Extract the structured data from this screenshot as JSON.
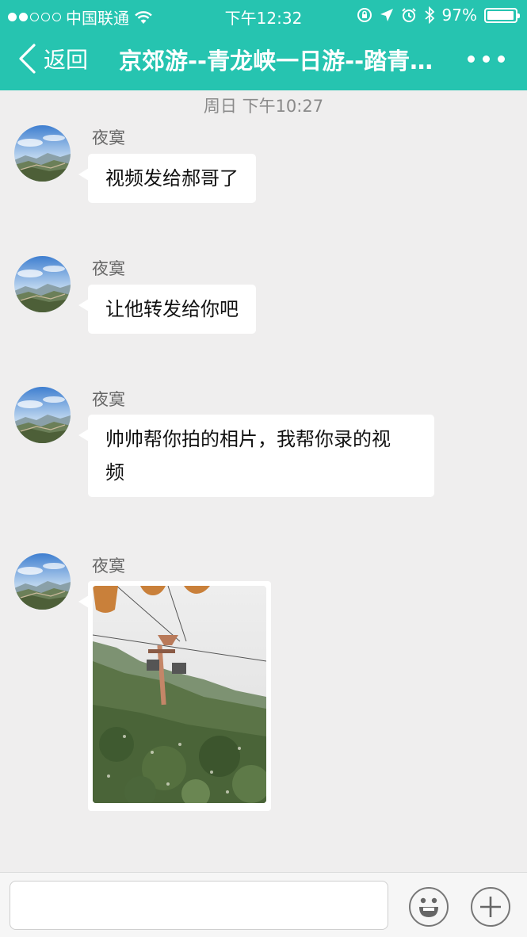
{
  "status_bar": {
    "carrier": "中国联通",
    "time": "下午12:32",
    "battery": "97%",
    "battery_level": 0.97,
    "signal_bars": 2
  },
  "nav": {
    "back_label": "返回",
    "title": "京郊游--青龙峡一日游--踏青…"
  },
  "chat": {
    "timestamp": "周日 下午10:27",
    "messages": [
      {
        "sender": "夜寞",
        "text": "视频发给郝哥了"
      },
      {
        "sender": "夜寞",
        "text": "让他转发给你吧"
      },
      {
        "sender": "夜寞",
        "text_line1": "帅帅帮你拍的相片，我帮你录的视",
        "text_line2": "频"
      },
      {
        "sender": "夜寞",
        "type": "image",
        "icon": "cable-car-photo"
      }
    ]
  },
  "input_bar": {
    "placeholder": "",
    "emoji_icon": "emoji-icon",
    "plus_icon": "plus-icon"
  },
  "colors": {
    "header": "#26c4b0",
    "background": "#efeeee"
  }
}
